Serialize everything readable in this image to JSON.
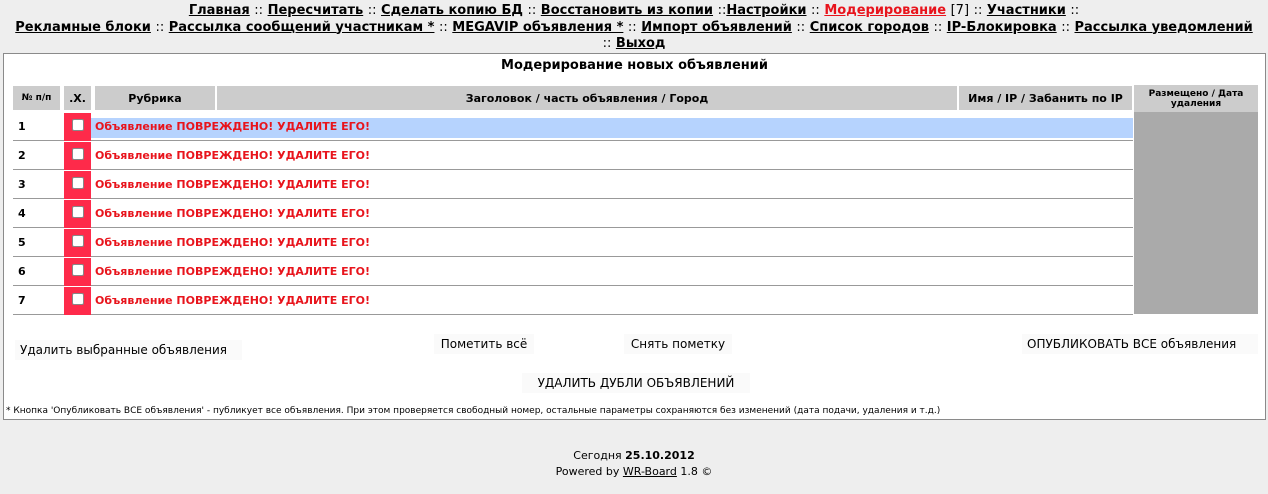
{
  "nav": {
    "main": "Главная",
    "recalc": "Пересчитать",
    "backup": "Сделать копию БД",
    "restore": "Восстановить из копии",
    "settings": "Настройки",
    "moderation": "Модерирование",
    "moderation_count": "[7]",
    "members": "Участники",
    "ad_blocks": "Рекламные блоки",
    "mailing": "Рассылка сообщений участникам *",
    "megavip": "MEGAVIP объявления *",
    "import": "Импорт объявлений",
    "cities": "Список городов",
    "ipblock": "IP-Блокировка",
    "notify": "Рассылка уведомлений",
    "exit": "Выход",
    "sep": "::"
  },
  "panel": {
    "title": "Модерирование новых объявлений"
  },
  "table": {
    "headers": {
      "num": "№ п/п",
      "x": ".X.",
      "rubric": "Рубрика",
      "title": "Заголовок / часть объявления / Город",
      "name": "Имя / IP / Забанить по IP",
      "date": "Размещено / Дата удаления"
    },
    "rows": [
      {
        "num": "1",
        "text": "Объявление ПОВРЕЖДЕНО! УДАЛИТЕ ЕГО!"
      },
      {
        "num": "2",
        "text": "Объявление ПОВРЕЖДЕНО! УДАЛИТЕ ЕГО!"
      },
      {
        "num": "3",
        "text": "Объявление ПОВРЕЖДЕНО! УДАЛИТЕ ЕГО!"
      },
      {
        "num": "4",
        "text": "Объявление ПОВРЕЖДЕНО! УДАЛИТЕ ЕГО!"
      },
      {
        "num": "5",
        "text": "Объявление ПОВРЕЖДЕНО! УДАЛИТЕ ЕГО!"
      },
      {
        "num": "6",
        "text": "Объявление ПОВРЕЖДЕНО! УДАЛИТЕ ЕГО!"
      },
      {
        "num": "7",
        "text": "Объявление ПОВРЕЖДЕНО! УДАЛИТЕ ЕГО!"
      }
    ]
  },
  "buttons": {
    "delete_selected": "Удалить выбранные объявления",
    "mark_all": "Пометить всё",
    "unmark": "Снять пометку",
    "publish_all": "ОПУБЛИКОВАТЬ ВСЕ объявления",
    "delete_dups": "УДАЛИТЬ ДУБЛИ ОБЪЯВЛЕНИЙ"
  },
  "footnote": "* Кнопка 'Опубликовать ВСЕ объявления' - публикует все объявления. При этом проверяется свободный номер, остальные параметры сохраняются без изменений (дата подачи, удаления и т.д.)",
  "footer": {
    "today_label": "Сегодня",
    "date": "25.10.2012",
    "powered_by": "Powered by",
    "brand": "WR-Board",
    "version": "1.8 ©"
  },
  "colors": {
    "accent_red": "#e8141c",
    "checkbox_bg": "#fe2a4a",
    "highlight_row": "#b6d3fe"
  }
}
